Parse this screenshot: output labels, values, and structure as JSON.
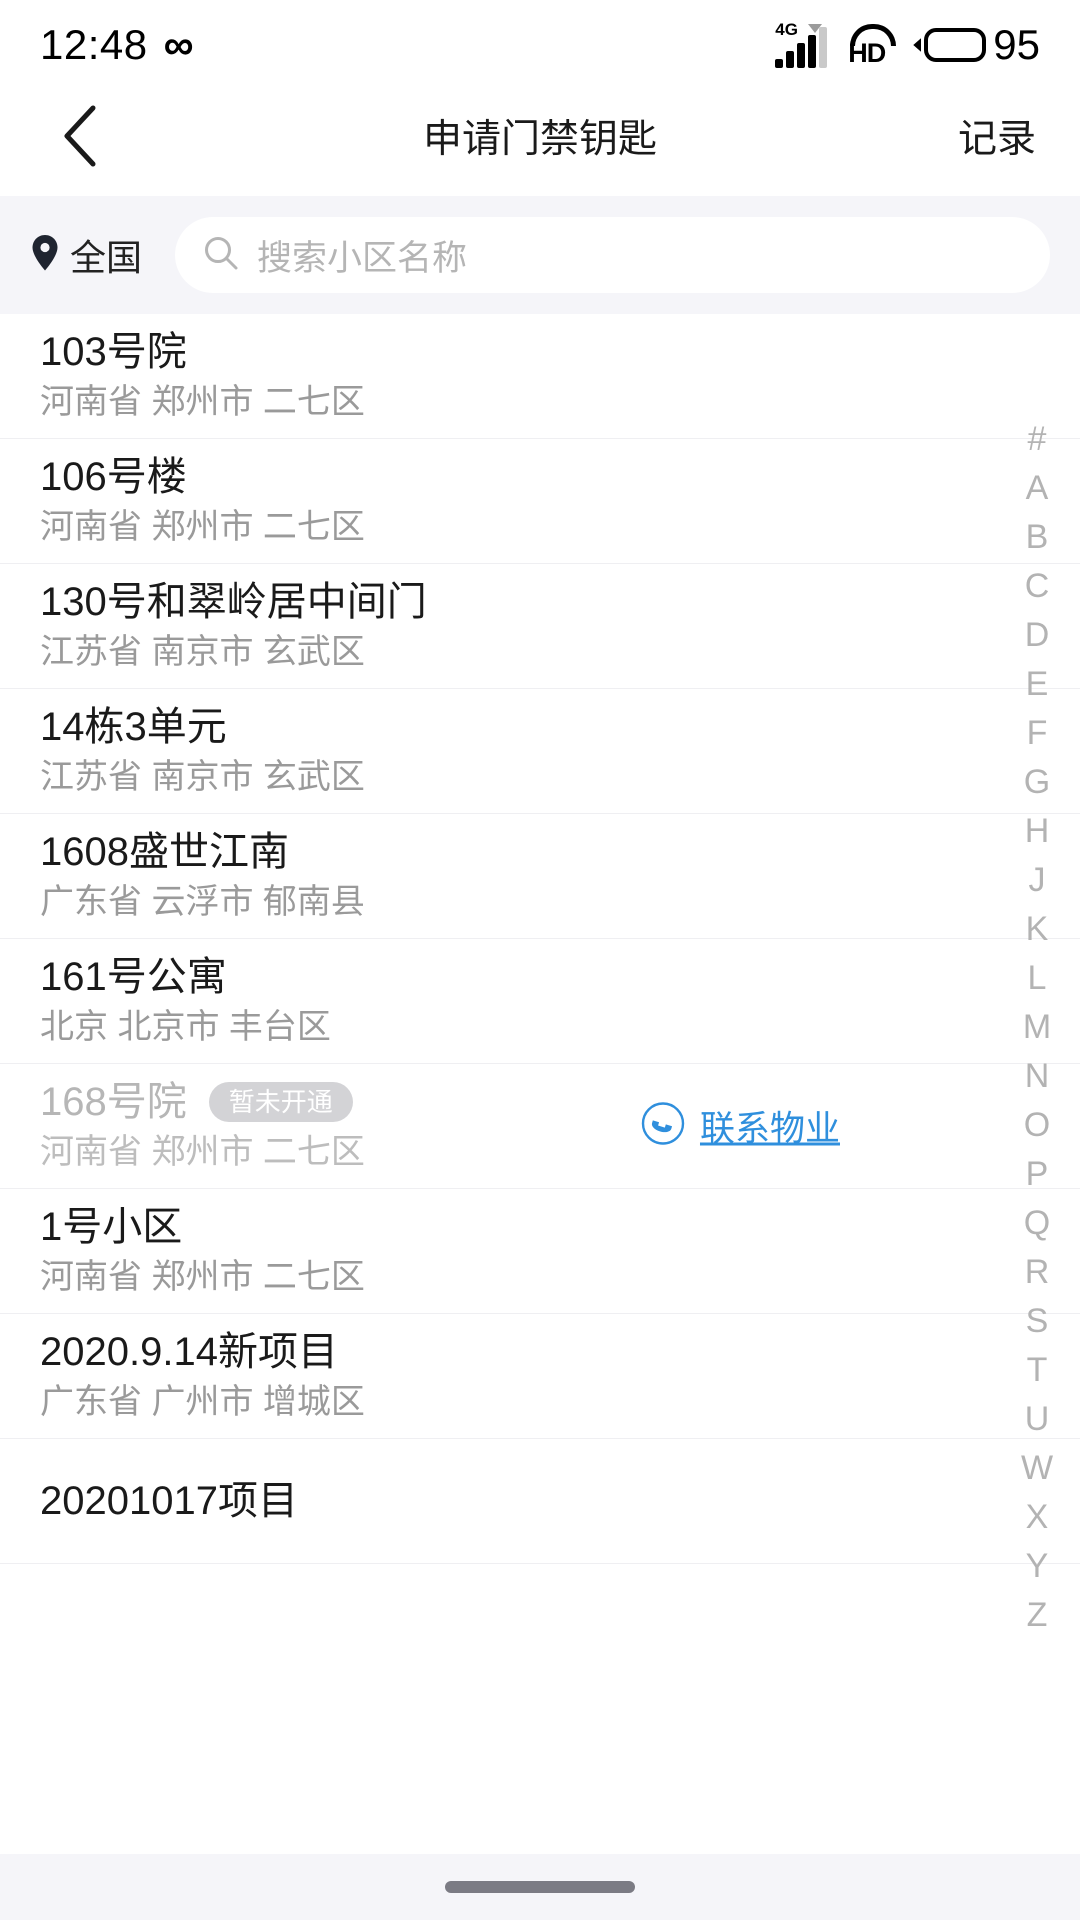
{
  "status_bar": {
    "time": "12:48",
    "infinity_icon": "infinity-icon",
    "network_type": "4G",
    "volte_label": "HD",
    "battery_percent": "95"
  },
  "nav_bar": {
    "back_icon": "chevron-left-icon",
    "title": "申请门禁钥匙",
    "action_label": "记录"
  },
  "search": {
    "location_icon": "map-pin-icon",
    "location_label": "全国",
    "search_icon": "search-icon",
    "placeholder": "搜索小区名称",
    "value": ""
  },
  "list": {
    "items": [
      {
        "name": "103号院",
        "region": "河南省 郑州市 二七区",
        "disabled": false,
        "badge": "",
        "contact": ""
      },
      {
        "name": "106号楼",
        "region": "河南省 郑州市 二七区",
        "disabled": false,
        "badge": "",
        "contact": ""
      },
      {
        "name": "130号和翠岭居中间门",
        "region": "江苏省 南京市 玄武区",
        "disabled": false,
        "badge": "",
        "contact": ""
      },
      {
        "name": "14栋3单元",
        "region": "江苏省 南京市 玄武区",
        "disabled": false,
        "badge": "",
        "contact": ""
      },
      {
        "name": "1608盛世江南",
        "region": "广东省 云浮市 郁南县",
        "disabled": false,
        "badge": "",
        "contact": ""
      },
      {
        "name": "161号公寓",
        "region": "北京 北京市 丰台区",
        "disabled": false,
        "badge": "",
        "contact": ""
      },
      {
        "name": "168号院",
        "region": "河南省 郑州市 二七区",
        "disabled": true,
        "badge": "暂未开通",
        "contact": "联系物业"
      },
      {
        "name": "1号小区",
        "region": "河南省 郑州市 二七区",
        "disabled": false,
        "badge": "",
        "contact": ""
      },
      {
        "name": "2020.9.14新项目",
        "region": "广东省 广州市 增城区",
        "disabled": false,
        "badge": "",
        "contact": ""
      },
      {
        "name": "20201017项目",
        "region": "",
        "disabled": false,
        "badge": "",
        "contact": ""
      }
    ]
  },
  "index_bar": {
    "letters": [
      "#",
      "A",
      "B",
      "C",
      "D",
      "E",
      "F",
      "G",
      "H",
      "J",
      "K",
      "L",
      "M",
      "N",
      "O",
      "P",
      "Q",
      "R",
      "S",
      "T",
      "U",
      "W",
      "X",
      "Y",
      "Z"
    ]
  },
  "colors": {
    "accent_link": "#2f8fdd",
    "badge_bg": "#d3d3d6",
    "page_bg": "#f5f5f9",
    "row_bg": "#ffffff",
    "text_primary": "#1a1a1a",
    "text_secondary": "#9a9a9a",
    "index_text": "#b3b3b3"
  }
}
